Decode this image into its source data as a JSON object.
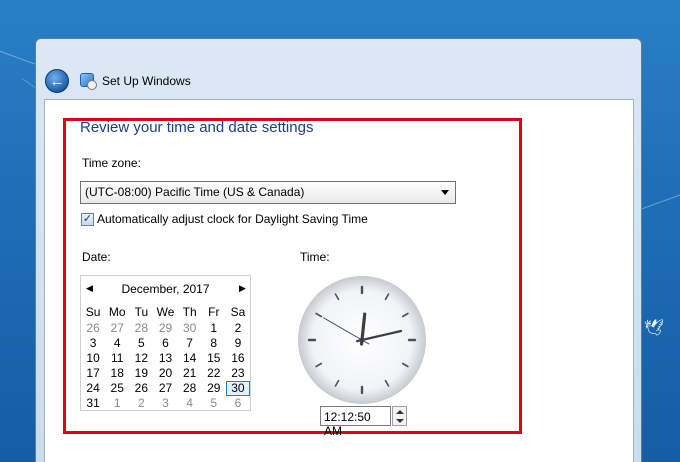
{
  "window": {
    "title": "Set Up Windows"
  },
  "page": {
    "heading": "Review your time and date settings",
    "time_zone_label": "Time zone:",
    "time_zone_value": "(UTC-08:00) Pacific Time (US & Canada)",
    "dst_label": "Automatically adjust clock for Daylight Saving Time",
    "dst_checked": true,
    "date_label": "Date:",
    "time_label": "Time:"
  },
  "calendar": {
    "month": "December, 2017",
    "weekdays": [
      "Su",
      "Mo",
      "Tu",
      "We",
      "Th",
      "Fr",
      "Sa"
    ],
    "weeks": [
      [
        {
          "d": "26",
          "o": true
        },
        {
          "d": "27",
          "o": true
        },
        {
          "d": "28",
          "o": true
        },
        {
          "d": "29",
          "o": true
        },
        {
          "d": "30",
          "o": true
        },
        {
          "d": "1"
        },
        {
          "d": "2"
        }
      ],
      [
        {
          "d": "3"
        },
        {
          "d": "4"
        },
        {
          "d": "5"
        },
        {
          "d": "6"
        },
        {
          "d": "7"
        },
        {
          "d": "8"
        },
        {
          "d": "9"
        }
      ],
      [
        {
          "d": "10"
        },
        {
          "d": "11"
        },
        {
          "d": "12"
        },
        {
          "d": "13"
        },
        {
          "d": "14"
        },
        {
          "d": "15"
        },
        {
          "d": "16"
        }
      ],
      [
        {
          "d": "17"
        },
        {
          "d": "18"
        },
        {
          "d": "19"
        },
        {
          "d": "20"
        },
        {
          "d": "21"
        },
        {
          "d": "22"
        },
        {
          "d": "23"
        }
      ],
      [
        {
          "d": "24"
        },
        {
          "d": "25"
        },
        {
          "d": "26"
        },
        {
          "d": "27"
        },
        {
          "d": "28"
        },
        {
          "d": "29"
        },
        {
          "d": "30",
          "sel": true
        }
      ],
      [
        {
          "d": "31"
        },
        {
          "d": "1",
          "o": true
        },
        {
          "d": "2",
          "o": true
        },
        {
          "d": "3",
          "o": true
        },
        {
          "d": "4",
          "o": true
        },
        {
          "d": "5",
          "o": true
        },
        {
          "d": "6",
          "o": true
        }
      ]
    ]
  },
  "clock": {
    "hour": 12,
    "minute": 12,
    "second": 50
  },
  "time_value": "12:12:50 AM",
  "colors": {
    "highlight": "#e0001b",
    "heading": "#1e3d8f",
    "selected_day_border": "#2b7ad1"
  },
  "icons": {
    "back": "back-arrow-icon",
    "app": "setup-windows-icon",
    "prev": "chevron-left-icon",
    "next": "chevron-right-icon"
  }
}
